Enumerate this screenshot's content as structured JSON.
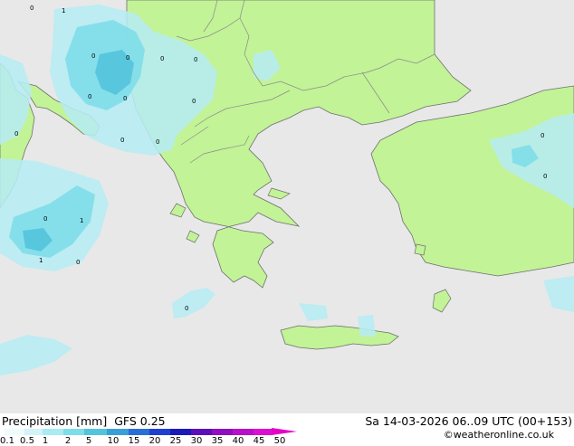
{
  "title": "Precipitation [mm]",
  "model": "GFS 0.25",
  "valid_time": "Sa 14-03-2026 06..09 UTC (00+153)",
  "credit": "©weatheronline.co.uk",
  "colors": {
    "sea": "#e8e8e8",
    "land": "#c2f397",
    "border": "#8a8a8a",
    "coast": "#6e6e6e",
    "precip_light": "#b6ecf2",
    "precip_moderate": "#7ddde9",
    "precip_heavy": "#52c4dc"
  },
  "legend": {
    "ticks": [
      "0.1",
      "0.5",
      "1",
      "2",
      "5",
      "10",
      "15",
      "20",
      "25",
      "30",
      "35",
      "40",
      "45",
      "50"
    ],
    "colors": [
      "#f0fbfc",
      "#d2f3f7",
      "#aaeaf2",
      "#7ddde9",
      "#52c4dc",
      "#3a9fd8",
      "#2a6fd6",
      "#1f3fd0",
      "#1a1ab8",
      "#5a0fb8",
      "#8e0fc0",
      "#b80fc8",
      "#dc0fd0",
      "#e400c8"
    ]
  },
  "contour_labels": [
    "0",
    "1",
    "0",
    "0",
    "0",
    "0",
    "0",
    "0",
    "0",
    "0",
    "0",
    "0",
    "0",
    "1",
    "1",
    "0",
    "0",
    "0",
    "0"
  ]
}
